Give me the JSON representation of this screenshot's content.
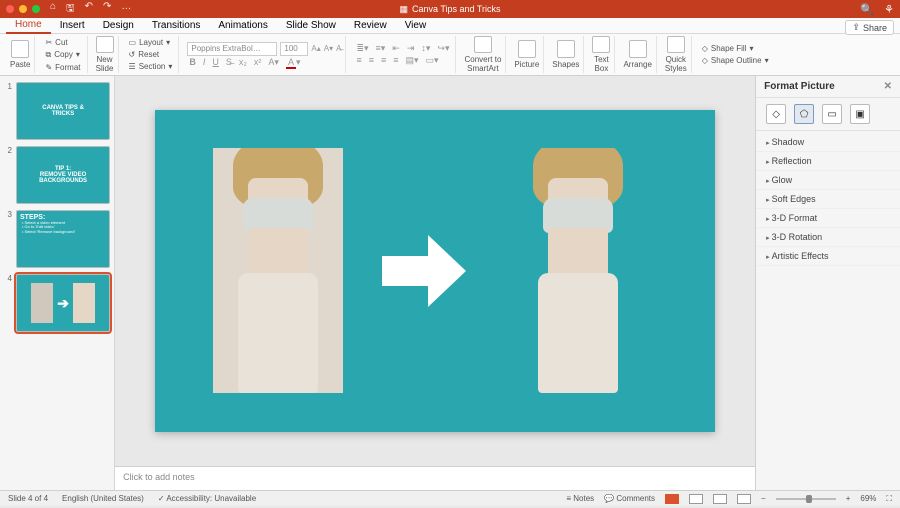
{
  "titlebar": {
    "doc_title": "Canva Tips and Tricks"
  },
  "menu": {
    "items": [
      "Home",
      "Insert",
      "Design",
      "Transitions",
      "Animations",
      "Slide Show",
      "Review",
      "View"
    ],
    "share": "Share"
  },
  "ribbon": {
    "paste": "Paste",
    "cut": "Cut",
    "copy": "Copy",
    "format_painter": "Format",
    "new_slide": "New\nSlide",
    "layout": "Layout",
    "reset": "Reset",
    "section": "Section",
    "font_name": "Poppins ExtraBol…",
    "font_size": "100",
    "convert": "Convert to\nSmartArt",
    "picture": "Picture",
    "shapes": "Shapes",
    "textbox": "Text\nBox",
    "arrange": "Arrange",
    "quick": "Quick\nStyles",
    "shape_fill": "Shape Fill",
    "shape_outline": "Shape Outline"
  },
  "thumbs": [
    {
      "n": "1",
      "title": "CANVA TIPS &\nTRICKS"
    },
    {
      "n": "2",
      "title": "TIP 1:\nREMOVE VIDEO\nBACKGROUNDS"
    },
    {
      "n": "3",
      "title": "STEPS:",
      "body": "• Select a video element\n• Go to 'Edit video'\n• Select 'Remove background'"
    },
    {
      "n": "4",
      "title": ""
    }
  ],
  "notes": {
    "placeholder": "Click to add notes"
  },
  "fmtpane": {
    "title": "Format Picture",
    "sections": [
      "Shadow",
      "Reflection",
      "Glow",
      "Soft Edges",
      "3-D Format",
      "3-D Rotation",
      "Artistic Effects"
    ]
  },
  "status": {
    "slide": "Slide 4 of 4",
    "lang": "English (United States)",
    "access": "Accessibility: Unavailable",
    "notes": "Notes",
    "comments": "Comments",
    "zoom": "69%"
  }
}
